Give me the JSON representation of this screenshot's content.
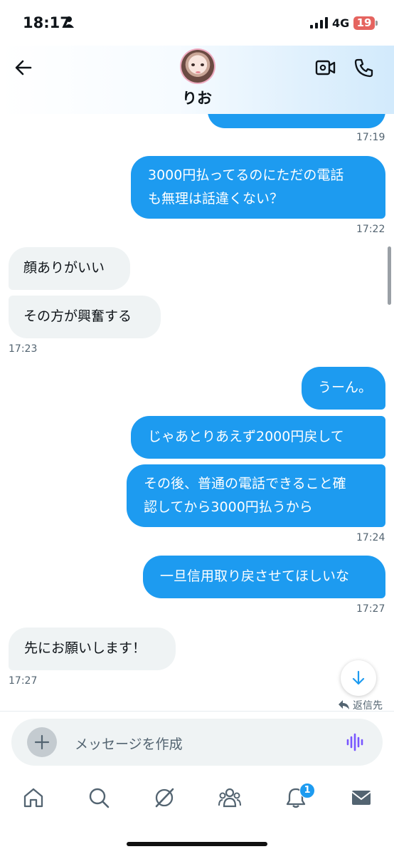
{
  "status_bar": {
    "time": "18:17",
    "network": "4G",
    "battery": "19"
  },
  "header": {
    "name": "りお"
  },
  "messages": [
    {
      "dir": "out",
      "lines": [
        "3000円払ってるのにただの電話",
        "も無理は話違くない？"
      ]
    },
    {
      "dir": "in",
      "lines": [
        "顔ありがいい"
      ]
    },
    {
      "dir": "in",
      "lines": [
        "その方が興奮する"
      ]
    },
    {
      "dir": "out",
      "lines": [
        "うーん。"
      ]
    },
    {
      "dir": "out",
      "lines": [
        "じゃあとりあえず2000円戻して"
      ]
    },
    {
      "dir": "out",
      "lines": [
        "その後、普通の電話できること確",
        "認してから3000円払うから"
      ]
    },
    {
      "dir": "out",
      "lines": [
        "一旦信用取り戻させてほしいな"
      ]
    },
    {
      "dir": "in",
      "lines": [
        "先にお願いします！"
      ]
    }
  ],
  "timestamps": [
    "17:19",
    "17:22",
    "17:23",
    "17:24",
    "17:27",
    "17:27"
  ],
  "reply_label": "返信先",
  "composer": {
    "placeholder": "メッセージを作成"
  },
  "tabbar": {
    "notifications_badge": "1"
  },
  "colors": {
    "accent": "#1d9bf0",
    "incoming_bubble": "#eff3f4",
    "battery": "#e5645f"
  }
}
